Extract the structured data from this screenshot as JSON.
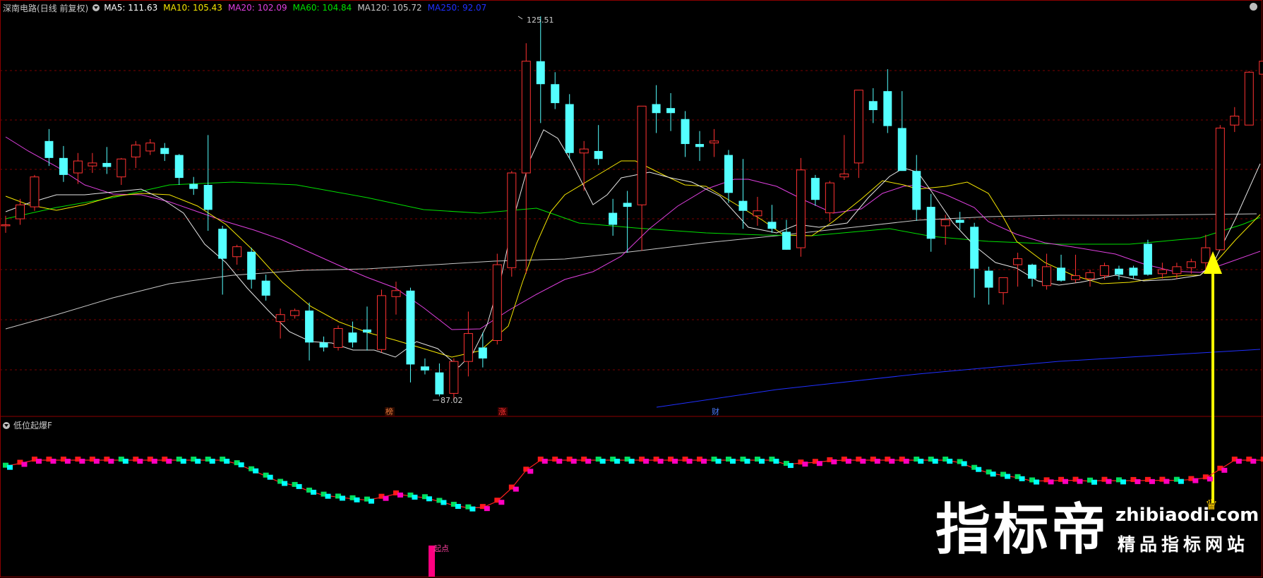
{
  "stock": {
    "name": "深南电路",
    "mode": "(日线 前复权)"
  },
  "ma_legend": [
    {
      "label": "MA5: 111.63",
      "color": "#ffffff"
    },
    {
      "label": "MA10: 105.43",
      "color": "#f5e600"
    },
    {
      "label": "MA20: 102.09",
      "color": "#e040e0"
    },
    {
      "label": "MA60: 104.84",
      "color": "#00e000"
    },
    {
      "label": "MA120: 105.72",
      "color": "#c8c8c8"
    },
    {
      "label": "MA250: 92.07",
      "color": "#2030ff"
    }
  ],
  "annotations": {
    "high": "125.51",
    "low": "87.02"
  },
  "event_markers": [
    {
      "text": "榜",
      "color": "#e87a3a"
    },
    {
      "text": "涨",
      "color": "#ff3333"
    },
    {
      "text": "财",
      "color": "#4a7bff"
    }
  ],
  "indicator": {
    "name": "低位起爆F",
    "signal_label": "起点"
  },
  "watermark": {
    "big": "指标帝",
    "url": "zhibiaodi.com",
    "sub": "精品指标网站",
    "crown": "♛"
  },
  "colors": {
    "up": "#ff3232",
    "down": "#54ffff",
    "grid": "#7a0000",
    "frame": "#8b0000",
    "arrow": "#ffff00",
    "signal": "#ff0080"
  },
  "chart_data": {
    "type": "candlestick",
    "price_range": [
      84,
      129
    ],
    "candles": [
      [
        104.5,
        105.5,
        103.8,
        104.6
      ],
      [
        105.2,
        107.2,
        104.6,
        106.6
      ],
      [
        106.4,
        109.6,
        106.0,
        109.4
      ],
      [
        113.0,
        114.2,
        110.5,
        111.3
      ],
      [
        111.3,
        112.5,
        108.9,
        109.6
      ],
      [
        109.8,
        111.8,
        108.7,
        111.0
      ],
      [
        110.5,
        111.8,
        109.8,
        110.8
      ],
      [
        110.8,
        112.4,
        109.7,
        110.4
      ],
      [
        109.4,
        111.3,
        108.6,
        111.2
      ],
      [
        111.4,
        113.0,
        110.3,
        112.6
      ],
      [
        112.0,
        113.2,
        111.6,
        112.8
      ],
      [
        112.3,
        112.8,
        111.0,
        111.7
      ],
      [
        111.6,
        111.7,
        108.6,
        109.3
      ],
      [
        108.7,
        109.4,
        107.6,
        108.2
      ],
      [
        108.6,
        113.6,
        104.0,
        106.1
      ],
      [
        104.2,
        104.5,
        97.6,
        101.2
      ],
      [
        101.4,
        102.6,
        100.6,
        102.4
      ],
      [
        101.9,
        102.3,
        98.2,
        99.1
      ],
      [
        99.0,
        99.6,
        97.0,
        97.5
      ],
      [
        94.9,
        96.2,
        93.2,
        95.6
      ],
      [
        95.5,
        96.2,
        95.2,
        96.0
      ],
      [
        96.0,
        96.8,
        91.0,
        92.8
      ],
      [
        92.8,
        93.4,
        91.9,
        92.3
      ],
      [
        92.3,
        94.5,
        92.0,
        94.2
      ],
      [
        93.8,
        94.9,
        92.3,
        92.8
      ],
      [
        94.1,
        96.4,
        92.0,
        93.8
      ],
      [
        92.1,
        98.1,
        91.8,
        97.5
      ],
      [
        97.4,
        98.9,
        95.6,
        98.0
      ],
      [
        98.0,
        98.3,
        88.8,
        90.6
      ],
      [
        90.4,
        91.2,
        89.6,
        90.0
      ],
      [
        89.8,
        90.7,
        87.4,
        87.6
      ],
      [
        87.7,
        91.2,
        87.0,
        90.9
      ],
      [
        90.9,
        95.9,
        89.4,
        93.7
      ],
      [
        92.3,
        93.8,
        90.3,
        91.2
      ],
      [
        93.0,
        101.7,
        92.6,
        100.6
      ],
      [
        100.3,
        110.0,
        99.4,
        109.8
      ],
      [
        109.8,
        122.8,
        99.7,
        121.0
      ],
      [
        121.0,
        125.5,
        114.8,
        118.7
      ],
      [
        118.7,
        119.9,
        116.2,
        116.8
      ],
      [
        116.7,
        117.7,
        111.2,
        111.8
      ],
      [
        111.8,
        113.0,
        108.0,
        112.2
      ],
      [
        112.0,
        114.6,
        110.6,
        111.2
      ],
      [
        105.8,
        107.2,
        103.5,
        104.6
      ],
      [
        106.8,
        108.0,
        101.8,
        106.4
      ],
      [
        106.6,
        116.0,
        102.0,
        116.5
      ],
      [
        116.7,
        118.6,
        113.8,
        115.8
      ],
      [
        116.3,
        117.8,
        114.0,
        115.8
      ],
      [
        115.2,
        116.0,
        111.4,
        112.7
      ],
      [
        112.7,
        114.0,
        111.0,
        112.4
      ],
      [
        112.8,
        114.2,
        111.4,
        113.0
      ],
      [
        111.6,
        112.1,
        106.8,
        107.8
      ],
      [
        107.0,
        111.2,
        104.2,
        106.0
      ],
      [
        105.5,
        107.4,
        104.5,
        106.0
      ],
      [
        104.9,
        106.6,
        103.8,
        104.2
      ],
      [
        103.9,
        105.1,
        102.1,
        102.1
      ],
      [
        102.3,
        111.3,
        101.4,
        110.1
      ],
      [
        109.3,
        109.6,
        106.5,
        107.1
      ],
      [
        105.8,
        109.0,
        104.9,
        108.8
      ],
      [
        109.4,
        113.6,
        109.1,
        109.7
      ],
      [
        110.8,
        118.1,
        109.3,
        118.1
      ],
      [
        117.0,
        118.3,
        114.8,
        116.1
      ],
      [
        118.0,
        120.2,
        113.8,
        114.5
      ],
      [
        114.3,
        118.0,
        112.6,
        110.0
      ],
      [
        110.0,
        111.6,
        105.0,
        106.1
      ],
      [
        106.4,
        107.7,
        101.9,
        103.2
      ],
      [
        104.5,
        105.6,
        102.6,
        105.1
      ],
      [
        105.1,
        105.9,
        104.1,
        104.8
      ],
      [
        104.4,
        104.8,
        97.3,
        100.2
      ],
      [
        100.0,
        100.4,
        96.6,
        98.3
      ],
      [
        97.8,
        99.1,
        96.6,
        99.3
      ],
      [
        100.6,
        101.8,
        98.4,
        101.2
      ],
      [
        100.6,
        100.7,
        98.4,
        99.2
      ],
      [
        98.5,
        101.7,
        98.1,
        100.4
      ],
      [
        100.3,
        101.6,
        98.9,
        99.0
      ],
      [
        99.1,
        101.6,
        98.8,
        99.5
      ],
      [
        99.2,
        100.1,
        98.4,
        99.8
      ],
      [
        99.5,
        100.8,
        99.1,
        100.5
      ],
      [
        100.2,
        100.5,
        99.1,
        99.6
      ],
      [
        100.3,
        100.5,
        99.2,
        99.5
      ],
      [
        102.7,
        103.1,
        99.5,
        99.6
      ],
      [
        99.7,
        100.8,
        99.2,
        100.1
      ],
      [
        99.7,
        100.8,
        99.2,
        100.4
      ],
      [
        100.3,
        101.2,
        99.7,
        100.9
      ],
      [
        100.8,
        103.6,
        99.8,
        102.3
      ],
      [
        102.1,
        114.6,
        102.4,
        114.3
      ],
      [
        114.6,
        116.4,
        113.9,
        115.5
      ],
      [
        114.6,
        120.0,
        114.6,
        119.9
      ],
      [
        119.7,
        121.9,
        119.6,
        121.0
      ]
    ],
    "indicator_signal_index": 30
  }
}
